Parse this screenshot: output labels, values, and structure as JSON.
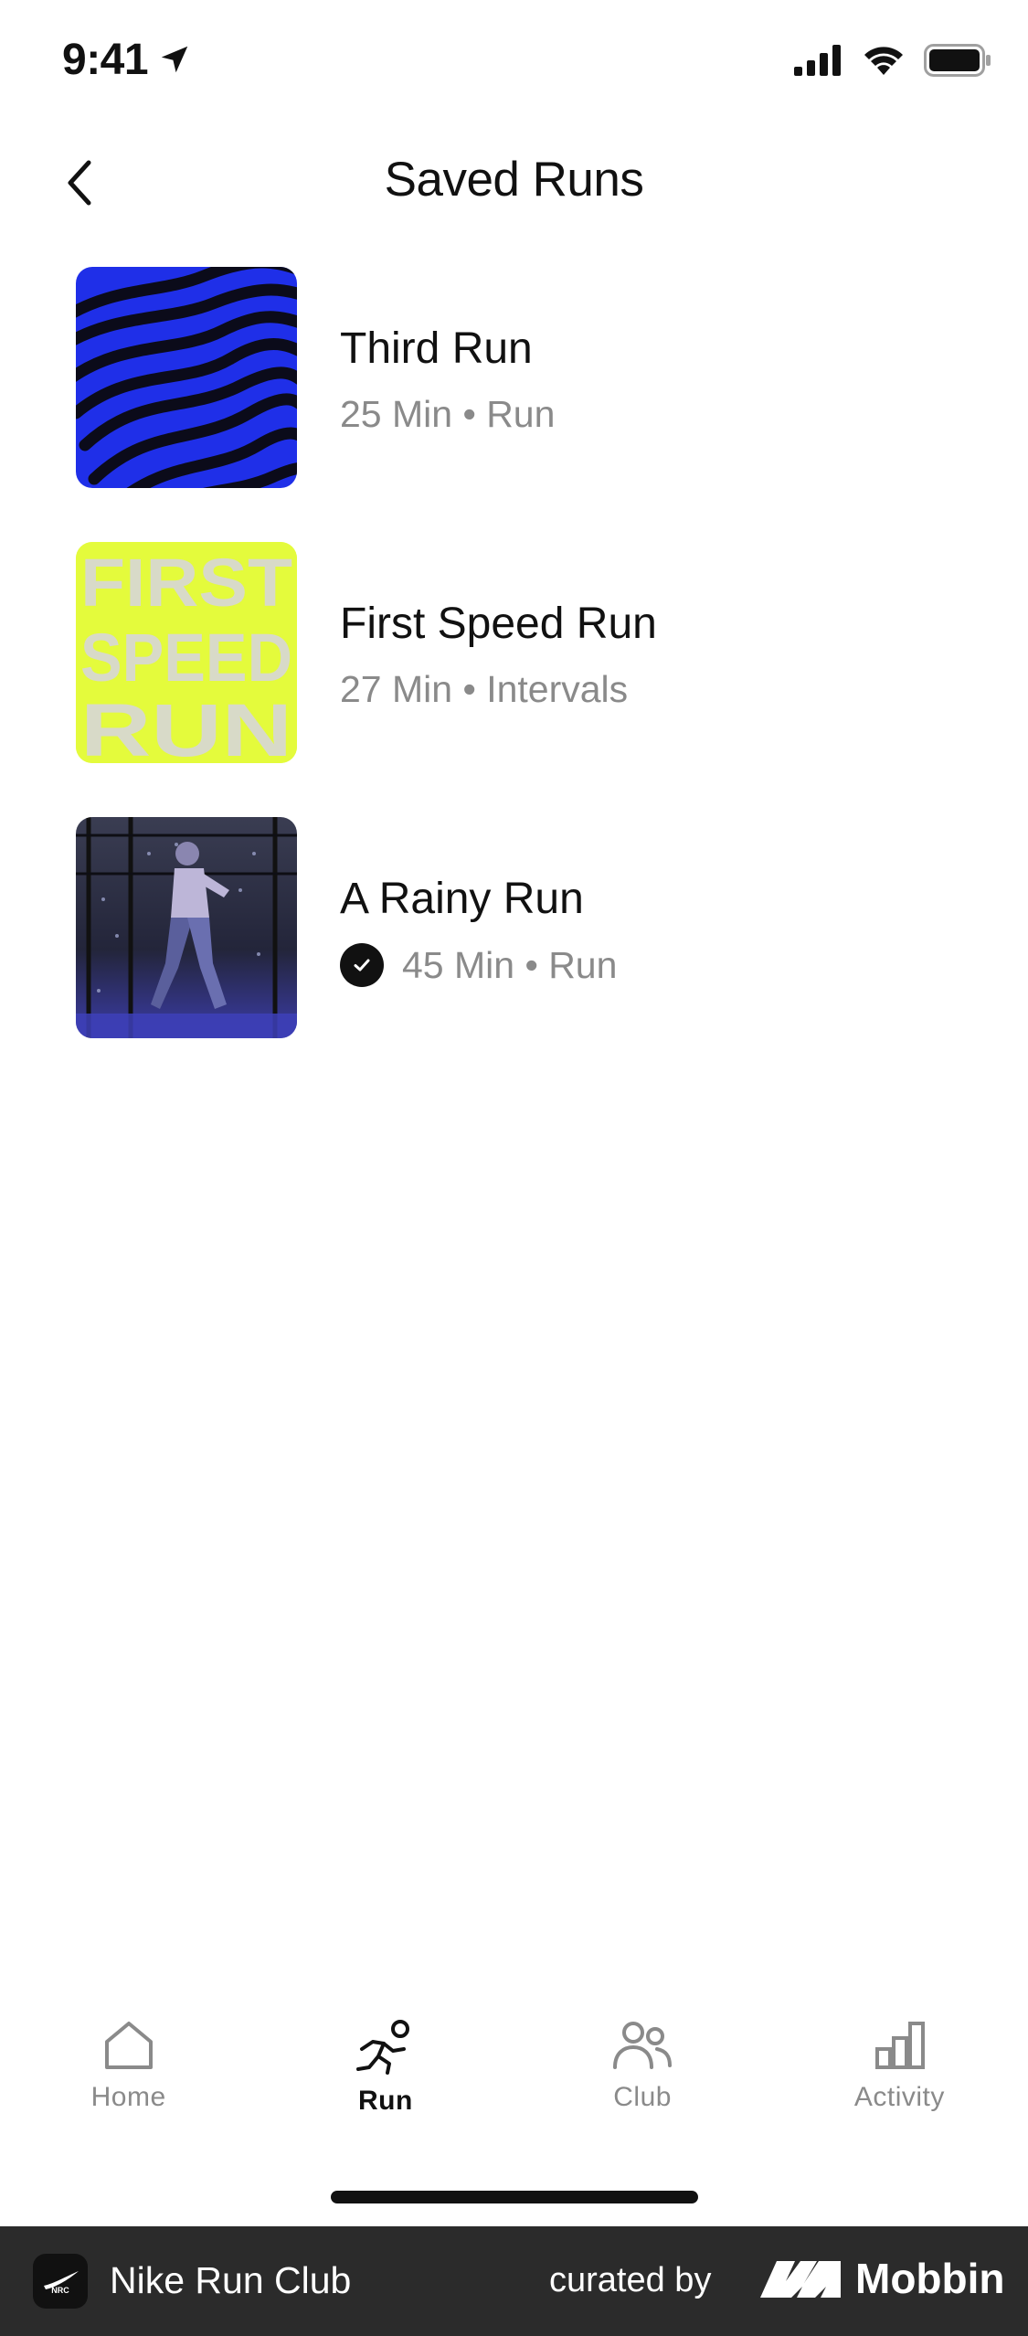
{
  "status_bar": {
    "time": "9:41"
  },
  "nav": {
    "title": "Saved Runs"
  },
  "runs": [
    {
      "title": "Third Run",
      "duration": "25 Min",
      "type": "Run",
      "completed": false
    },
    {
      "title": "First Speed Run",
      "duration": "27 Min",
      "type": "Intervals",
      "completed": false,
      "art_text": [
        "FIRST",
        "SPEED",
        "RUN"
      ]
    },
    {
      "title": "A Rainy Run",
      "duration": "45 Min",
      "type": "Run",
      "completed": true
    }
  ],
  "tabbar": {
    "items": [
      {
        "label": "Home",
        "icon": "home-icon",
        "active": false
      },
      {
        "label": "Run",
        "icon": "runner-icon",
        "active": true
      },
      {
        "label": "Club",
        "icon": "people-icon",
        "active": false
      },
      {
        "label": "Activity",
        "icon": "bar-chart-icon",
        "active": false
      }
    ]
  },
  "footer": {
    "app_name": "Nike Run Club",
    "curated_by": "curated by",
    "brand": "Mobbin"
  },
  "colors": {
    "accent_blue": "#1f2fe8",
    "accent_lime": "#e4fb3c",
    "muted_text": "#8a8a8a"
  }
}
